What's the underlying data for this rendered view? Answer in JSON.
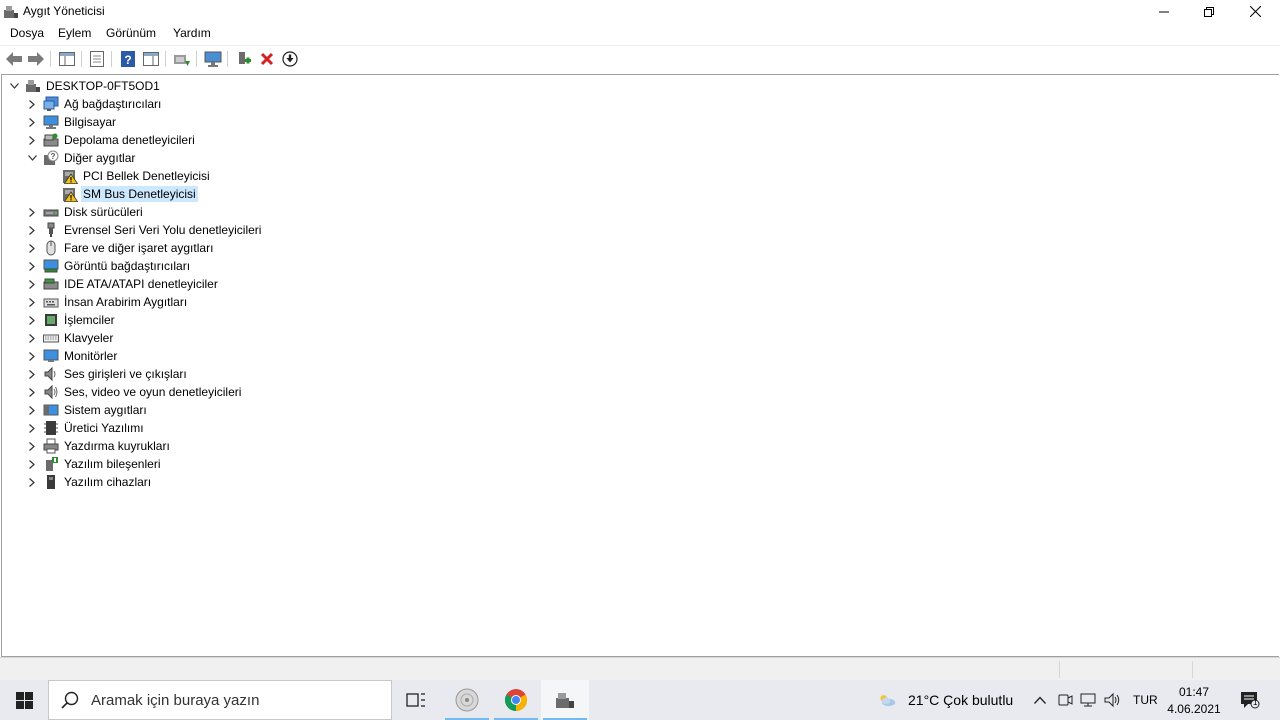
{
  "window": {
    "title": "Aygıt Yöneticisi"
  },
  "menu": {
    "items": [
      "Dosya",
      "Eylem",
      "Görünüm",
      "Yardım"
    ]
  },
  "tree": {
    "root": "DESKTOP-0FT5OD1",
    "nodes": [
      {
        "label": "Ağ bağdaştırıcıları",
        "icon": "network-adapter-icon",
        "level": 1,
        "expander": "collapsed"
      },
      {
        "label": "Bilgisayar",
        "icon": "computer-icon",
        "level": 1,
        "expander": "collapsed"
      },
      {
        "label": "Depolama denetleyicileri",
        "icon": "storage-controller-icon",
        "level": 1,
        "expander": "collapsed"
      },
      {
        "label": "Diğer aygıtlar",
        "icon": "unknown-device-icon",
        "level": 1,
        "expander": "expanded"
      },
      {
        "label": "PCI Bellek Denetleyicisi",
        "icon": "warning-device-icon",
        "level": 2,
        "expander": "none"
      },
      {
        "label": "SM Bus Denetleyicisi",
        "icon": "warning-device-icon",
        "level": 2,
        "expander": "none",
        "selected": true
      },
      {
        "label": "Disk sürücüleri",
        "icon": "disk-drive-icon",
        "level": 1,
        "expander": "collapsed"
      },
      {
        "label": "Evrensel Seri Veri Yolu denetleyicileri",
        "icon": "usb-icon",
        "level": 1,
        "expander": "collapsed"
      },
      {
        "label": "Fare ve diğer işaret aygıtları",
        "icon": "mouse-icon",
        "level": 1,
        "expander": "collapsed"
      },
      {
        "label": "Görüntü bağdaştırıcıları",
        "icon": "display-adapter-icon",
        "level": 1,
        "expander": "collapsed"
      },
      {
        "label": "IDE ATA/ATAPI denetleyiciler",
        "icon": "ide-controller-icon",
        "level": 1,
        "expander": "collapsed"
      },
      {
        "label": "İnsan Arabirim Aygıtları",
        "icon": "hid-icon",
        "level": 1,
        "expander": "collapsed"
      },
      {
        "label": "İşlemciler",
        "icon": "processor-icon",
        "level": 1,
        "expander": "collapsed"
      },
      {
        "label": "Klavyeler",
        "icon": "keyboard-icon",
        "level": 1,
        "expander": "collapsed"
      },
      {
        "label": "Monitörler",
        "icon": "monitor-icon",
        "level": 1,
        "expander": "collapsed"
      },
      {
        "label": "Ses girişleri ve çıkışları",
        "icon": "speaker-icon",
        "level": 1,
        "expander": "collapsed"
      },
      {
        "label": "Ses, video ve oyun denetleyicileri",
        "icon": "sound-controller-icon",
        "level": 1,
        "expander": "collapsed"
      },
      {
        "label": "Sistem aygıtları",
        "icon": "system-devices-icon",
        "level": 1,
        "expander": "collapsed"
      },
      {
        "label": "Üretici Yazılımı",
        "icon": "firmware-icon",
        "level": 1,
        "expander": "collapsed"
      },
      {
        "label": "Yazdırma kuyrukları",
        "icon": "printer-icon",
        "level": 1,
        "expander": "collapsed"
      },
      {
        "label": "Yazılım bileşenleri",
        "icon": "software-component-icon",
        "level": 1,
        "expander": "collapsed"
      },
      {
        "label": "Yazılım cihazları",
        "icon": "software-device-icon",
        "level": 1,
        "expander": "collapsed"
      }
    ]
  },
  "taskbar": {
    "search_placeholder": "Aramak için buraya yazın",
    "weather": "21°C  Çok bulutlu",
    "language": "TUR",
    "time": "01:47",
    "date": "4.06.2021",
    "notification_count": "1"
  },
  "colors": {
    "selection": "#cce8ff",
    "accent": "#0078d7",
    "taskbar": "#e8eaef",
    "warning": "#f5c211"
  }
}
